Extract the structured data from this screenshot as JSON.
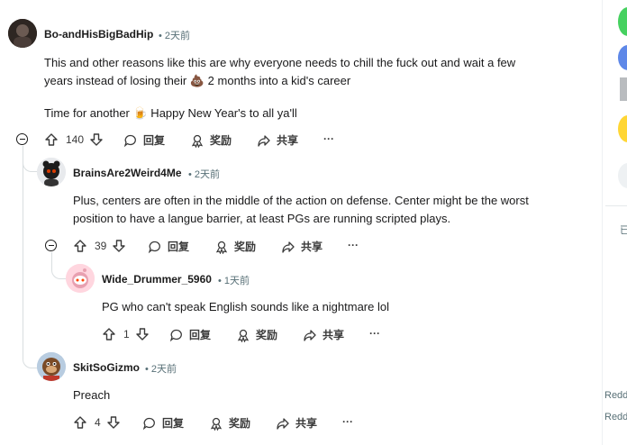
{
  "comments": [
    {
      "username": "Bo-andHisBigBadHip",
      "time": "2天前",
      "lines": [
        "This and other reasons like this are why everyone needs to chill the fuck out and wait a few",
        "years instead of losing their 💩 2 months into a kid's career",
        "Time for another 🍺 Happy New Year's to all ya'll"
      ],
      "votes": "140",
      "actions": {
        "reply": "回复",
        "award": "奖励",
        "share": "共享",
        "more": "···"
      }
    },
    {
      "username": "BrainsAre2Weird4Me",
      "time": "2天前",
      "lines": [
        "Plus, centers are often in the middle of the action on defense. Center might be the worst",
        "position to have a langue barrier, at least PGs are running scripted plays."
      ],
      "votes": "39",
      "actions": {
        "reply": "回复",
        "award": "奖励",
        "share": "共享",
        "more": "···"
      }
    },
    {
      "username": "Wide_Drummer_5960",
      "time": "1天前",
      "lines": [
        "PG who can't speak English sounds like a nightmare lol"
      ],
      "votes": "1",
      "actions": {
        "reply": "回复",
        "award": "奖励",
        "share": "共享",
        "more": "···"
      }
    },
    {
      "username": "SkitSoGizmo",
      "time": "2天前",
      "lines": [
        "Preach"
      ],
      "votes": "4",
      "actions": {
        "reply": "回复",
        "award": "奖励",
        "share": "共享",
        "more": "···"
      }
    }
  ],
  "sidebar": {
    "label_partial": "已",
    "footer_1": "Redd",
    "footer_2": "Redd"
  },
  "colors": {
    "accent_green": "#46d160",
    "accent_blue": "#5e88e8",
    "accent_yellow": "#ffd635",
    "thread_line": "#d9dee0",
    "meta_gray": "#576f76"
  }
}
